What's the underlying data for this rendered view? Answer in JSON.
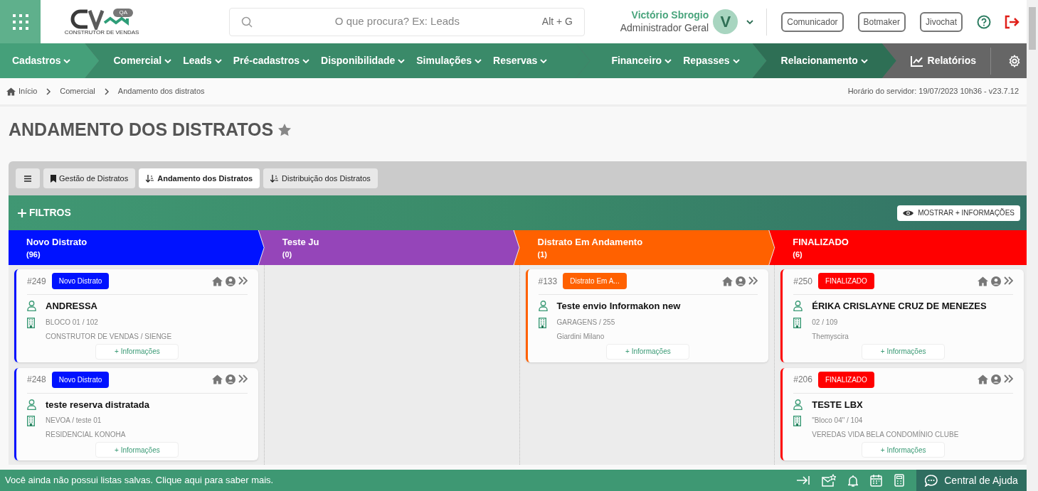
{
  "header": {
    "logo_badge": "QA",
    "logo_tagline": "CONSTRUTOR DE VENDAS",
    "search": {
      "placeholder": "O que procura? Ex: Leads",
      "shortcut": "Alt + G"
    },
    "user": {
      "name": "Victório Sbrogio",
      "role": "Administrador Geral",
      "initial": "V"
    },
    "buttons": [
      "Comunicador",
      "Botmaker",
      "Jivochat"
    ]
  },
  "nav": {
    "groups": [
      {
        "kind": "lead",
        "items": [
          "Cadastros"
        ]
      },
      {
        "kind": "main",
        "items": [
          "Comercial",
          "Leads",
          "Pré-cadastros",
          "Disponibilidade",
          "Simulações",
          "Reservas"
        ]
      },
      {
        "kind": "main",
        "items": [
          "Financeiro",
          "Repasses"
        ]
      },
      {
        "kind": "related",
        "items": [
          "Relacionamento"
        ]
      }
    ],
    "reports": "Relatórios"
  },
  "breadcrumb": [
    "Início",
    "Comercial",
    "Andamento dos distratos"
  ],
  "server_time": "Horário do servidor: 19/07/2023 10h36 - v23.7.12",
  "title": "ANDAMENTO DOS DISTRATOS",
  "tabs": [
    {
      "label": "Gestão de Distratos",
      "kind": "bookmark",
      "selected": false
    },
    {
      "label": "Andamento dos Distratos",
      "kind": "sort",
      "selected": true
    },
    {
      "label": "Distribuição dos Distratos",
      "kind": "sort",
      "selected": false
    }
  ],
  "filters": {
    "label": "FILTROS",
    "more_button": "MOSTRAR + INFORMAÇÕES"
  },
  "columns": [
    {
      "name": "Novo Distrato",
      "count": "(96)",
      "color": "#0012ff",
      "cards": [
        {
          "id": "#249",
          "status": "Novo Distrato",
          "name": "ANDRESSA",
          "unit": "BLOCO 01 / 102",
          "project": "CONSTRUTOR DE VENDAS / SIENGE",
          "button": "+ Informações"
        },
        {
          "id": "#248",
          "status": "Novo Distrato",
          "name": "teste reserva distratada",
          "unit": "NEVOA / teste 01",
          "project": "RESIDENCIAL KONOHA",
          "button": "+ Informações"
        }
      ]
    },
    {
      "name": "Teste Ju",
      "count": "(0)",
      "color": "#9545b9"
    },
    {
      "name": "Distrato Em Andamento",
      "count": "(1)",
      "color": "#ff6100",
      "cards": [
        {
          "id": "#133",
          "status": "Distrato Em A...",
          "name": "Teste envio Informakon new",
          "unit": "GARAGENS / 255",
          "project": "Giardini Milano",
          "button": "+ Informações"
        }
      ]
    },
    {
      "name": "FINALIZADO",
      "count": "(6)",
      "color": "#ff0000",
      "cards": [
        {
          "id": "#250",
          "status": "FINALIZADO",
          "name": "ÉRIKA CRISLAYNE CRUZ DE MENEZES",
          "unit": "02 / 109",
          "project": "Themyscira",
          "button": "+ Informações"
        },
        {
          "id": "#206",
          "status": "FINALIZADO",
          "name": "TESTE LBX",
          "unit": "\"Bloco 04\" / 104",
          "project": "VEREDAS VIDA BELA CONDOMÍNIO CLUBE",
          "button": "+ Informações"
        }
      ]
    }
  ],
  "footer": {
    "message": "Você ainda não possui listas salvas. Clique aqui para saber mais.",
    "help": "Central de Ajuda"
  }
}
